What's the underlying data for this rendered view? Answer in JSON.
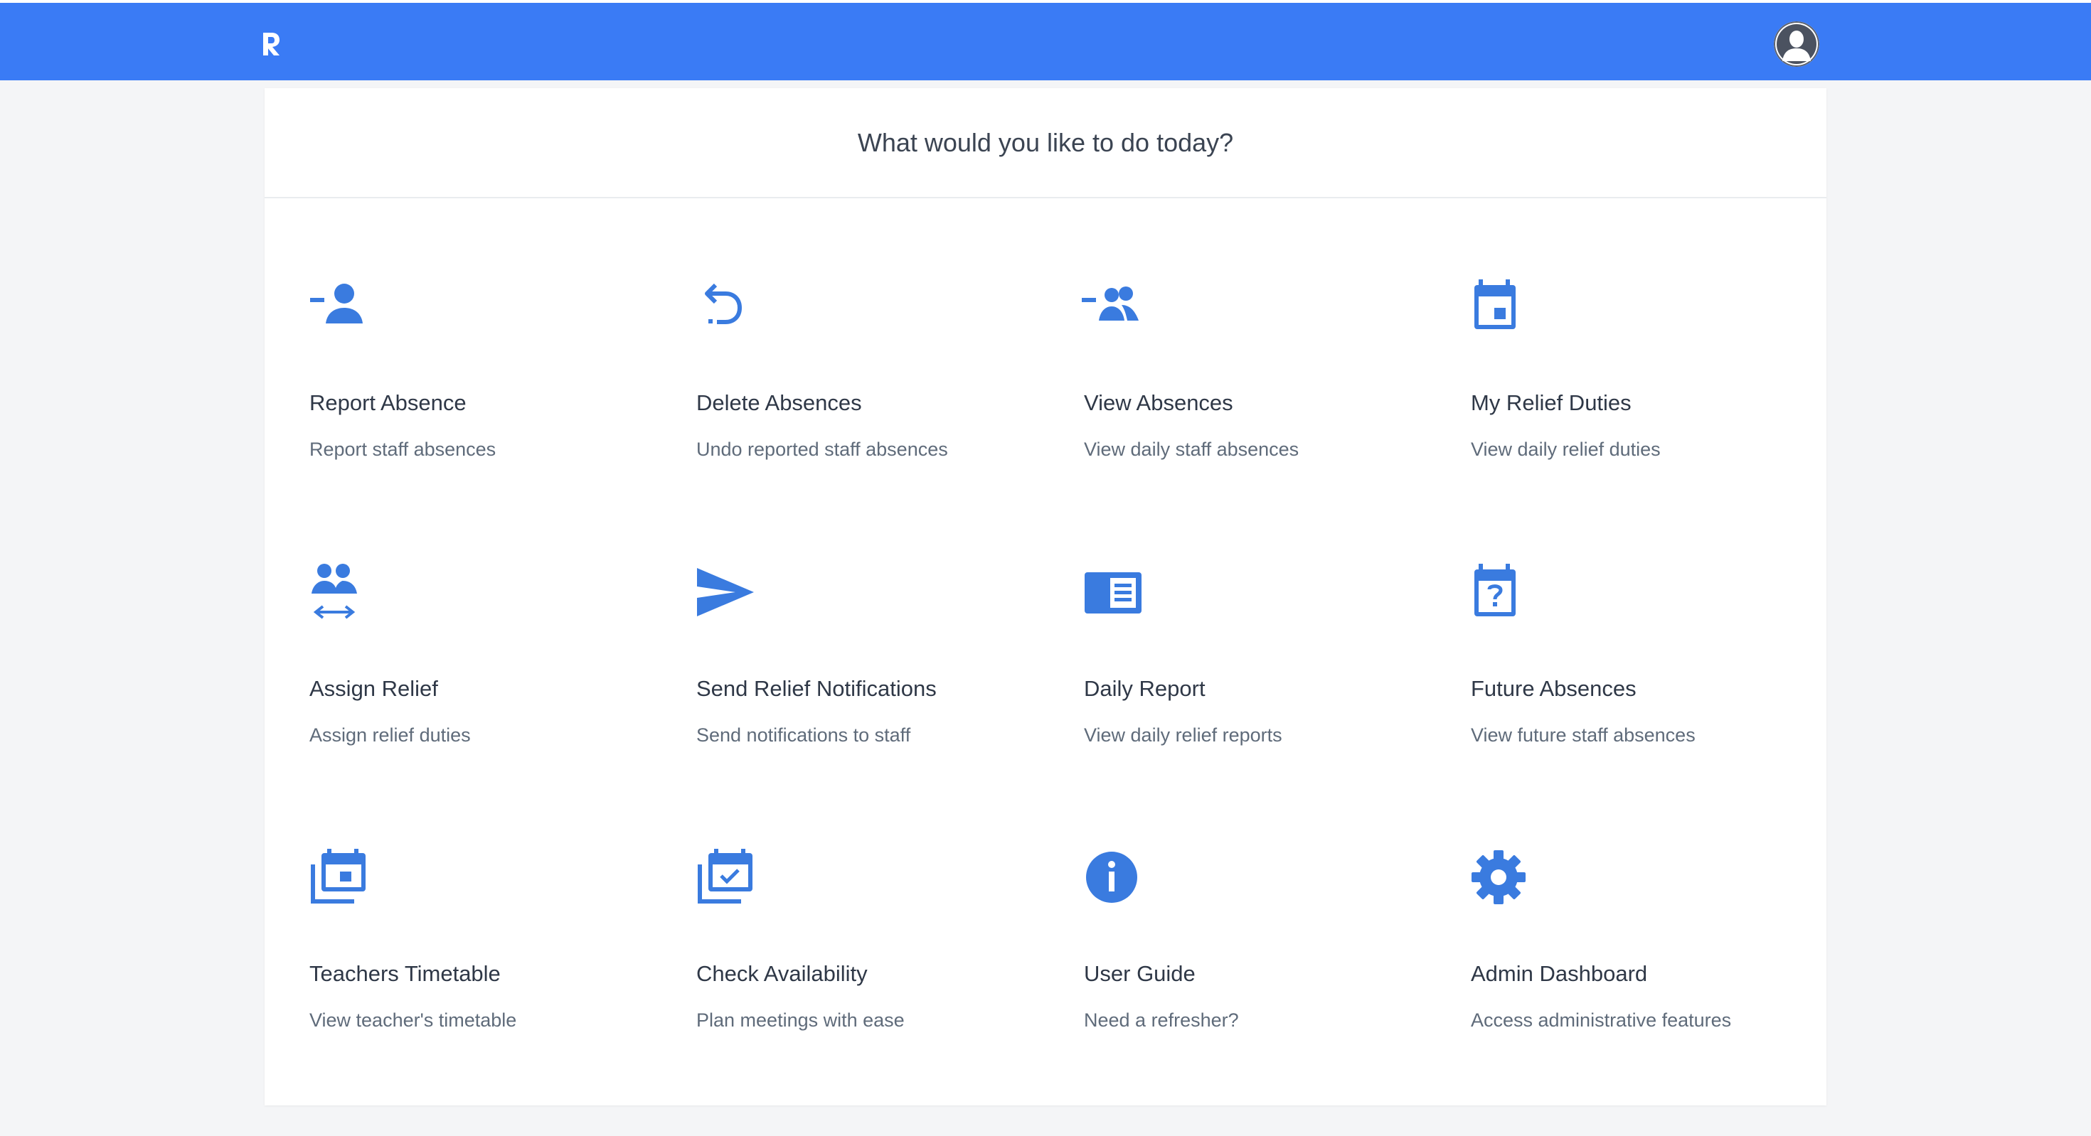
{
  "header": {
    "logo_letter": "R",
    "brand_color": "#3a7bf5",
    "avatar_icon": "user-avatar-icon"
  },
  "main": {
    "heading": "What would you like to do today?"
  },
  "theme": {
    "icon_color": "#3a7bdf"
  },
  "tiles": [
    {
      "title": "Report Absence",
      "description": "Report staff absences",
      "icon": "person-remove-icon"
    },
    {
      "title": "Delete Absences",
      "description": "Undo reported staff absences",
      "icon": "undo-icon"
    },
    {
      "title": "View Absences",
      "description": "View daily staff absences",
      "icon": "group-remove-icon"
    },
    {
      "title": "My Relief Duties",
      "description": "View daily relief duties",
      "icon": "calendar-event-icon"
    },
    {
      "title": "Assign Relief",
      "description": "Assign relief duties",
      "icon": "people-swap-icon"
    },
    {
      "title": "Send Relief Notifications",
      "description": "Send notifications to staff",
      "icon": "send-icon"
    },
    {
      "title": "Daily Report",
      "description": "View daily relief reports",
      "icon": "report-icon"
    },
    {
      "title": "Future Absences",
      "description": "View future staff absences",
      "icon": "calendar-question-icon"
    },
    {
      "title": "Teachers Timetable",
      "description": "View teacher's timetable",
      "icon": "calendar-stack-icon"
    },
    {
      "title": "Check Availability",
      "description": "Plan meetings with ease",
      "icon": "calendar-check-stack-icon"
    },
    {
      "title": "User Guide",
      "description": "Need a refresher?",
      "icon": "info-icon"
    },
    {
      "title": "Admin Dashboard",
      "description": "Access administrative features",
      "icon": "gear-icon"
    }
  ]
}
